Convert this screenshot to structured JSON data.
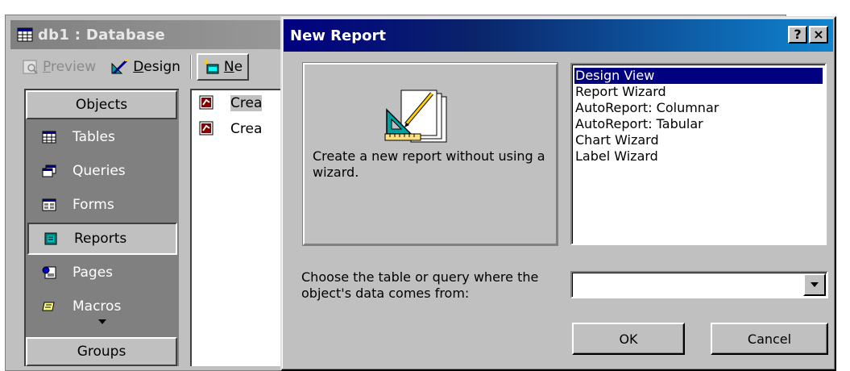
{
  "database_window": {
    "title": "db1 : Database",
    "toolbar": {
      "preview_label": "Preview",
      "design_label": "Design",
      "new_label": "Ne"
    },
    "objects_header": "Objects",
    "objects": [
      {
        "label": "Tables",
        "icon": "table-icon"
      },
      {
        "label": "Queries",
        "icon": "query-icon"
      },
      {
        "label": "Forms",
        "icon": "form-icon"
      },
      {
        "label": "Reports",
        "icon": "report-icon",
        "selected": true
      },
      {
        "label": "Pages",
        "icon": "page-icon"
      },
      {
        "label": "Macros",
        "icon": "macro-icon"
      }
    ],
    "groups_header": "Groups",
    "list_items": [
      {
        "label": "Crea",
        "icon": "report-shortcut-icon"
      },
      {
        "label": "Crea",
        "icon": "report-shortcut-icon"
      }
    ]
  },
  "dialog": {
    "title": "New Report",
    "help_label": "?",
    "close_label": "×",
    "preview_description": "Create a new report without using a wizard.",
    "wizard_options": [
      "Design View",
      "Report Wizard",
      "AutoReport:  Columnar",
      "AutoReport:  Tabular",
      "Chart Wizard",
      "Label Wizard"
    ],
    "selected_option_index": 0,
    "source_label": "Choose the table or query where the object's data comes from:",
    "source_value": "",
    "ok_label": "OK",
    "cancel_label": "Cancel"
  },
  "colors": {
    "dialog_title_bg": "#000080",
    "inactive_title_bg": "#808080",
    "face": "#c0c0c0",
    "selection": "#000080"
  }
}
